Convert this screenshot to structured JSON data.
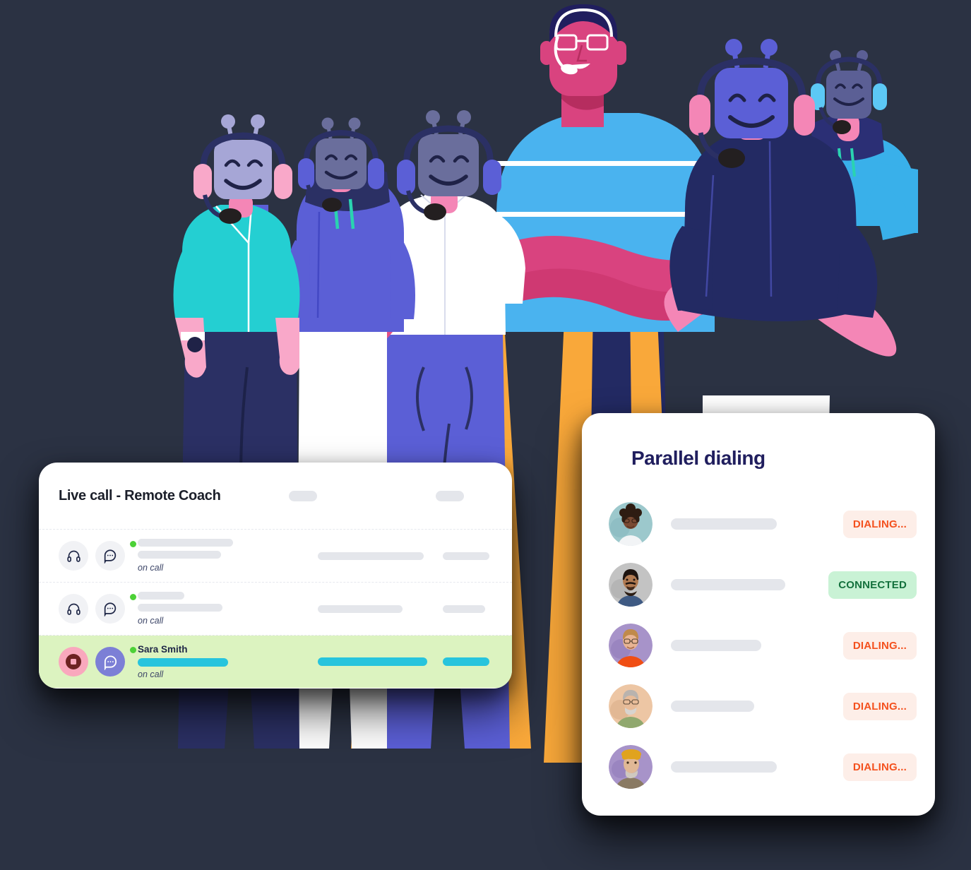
{
  "page": {
    "background_color": "#2b3243",
    "illustration_name": "team-of-agents-and-robots-with-headsets"
  },
  "live_call_card": {
    "title": "Live call - Remote Coach",
    "status_label": "on call",
    "accent_color": "#27c4dd",
    "active_row_background": "#dcf3c0",
    "online_dot_color": "#4cd137",
    "header_placeholders": [
      {
        "name": "header-pill-1",
        "width": 40
      },
      {
        "name": "header-pill-2",
        "width": 40
      }
    ],
    "rows": [
      {
        "name": "",
        "status": "on call",
        "active": false,
        "online": true,
        "icons": [
          "headphones-icon",
          "chat-bubble-icon"
        ],
        "skeleton_widths": [
          135,
          118
        ],
        "mid_skeleton_width": 150,
        "right_skeleton_width": 66
      },
      {
        "name": "",
        "status": "on call",
        "active": false,
        "online": true,
        "icons": [
          "headphones-icon",
          "chat-bubble-icon"
        ],
        "skeleton_widths": [
          66,
          120
        ],
        "mid_skeleton_width": 120,
        "right_skeleton_width": 60
      },
      {
        "name": "Sara Smith",
        "status": "on call",
        "active": true,
        "online": true,
        "icons": [
          "record-stop-icon",
          "chat-bubble-icon"
        ],
        "skeleton_widths": [
          128
        ],
        "mid_skeleton_width": 155,
        "right_skeleton_width": 66
      }
    ]
  },
  "parallel_dialing_card": {
    "title": "Parallel dialing",
    "title_color": "#201e5e",
    "rows": [
      {
        "avatar": "avatar-woman-curly-hair-glasses",
        "avatar_bg": "#9cc8cc",
        "skeleton_width": 150,
        "status": "DIALING...",
        "status_type": "dialing"
      },
      {
        "avatar": "avatar-man-beard-blue-shirt",
        "avatar_bg": "#c3c3c3",
        "skeleton_width": 162,
        "status": "CONNECTED",
        "status_type": "connected"
      },
      {
        "avatar": "avatar-man-glasses-orange-shirt",
        "avatar_bg": "#a793c9",
        "skeleton_width": 128,
        "status": "DIALING...",
        "status_type": "dialing"
      },
      {
        "avatar": "avatar-older-man-green-sweater",
        "avatar_bg": "#edc6a4",
        "skeleton_width": 118,
        "status": "DIALING...",
        "status_type": "dialing"
      },
      {
        "avatar": "avatar-man-yellow-beret",
        "avatar_bg": "#a793c9",
        "skeleton_width": 150,
        "status": "DIALING...",
        "status_type": "dialing"
      }
    ],
    "badge_colors": {
      "dialing_text": "#f4511e",
      "dialing_bg": "#fdeee8",
      "connected_text": "#14713d",
      "connected_bg": "#c9f2d5"
    }
  }
}
